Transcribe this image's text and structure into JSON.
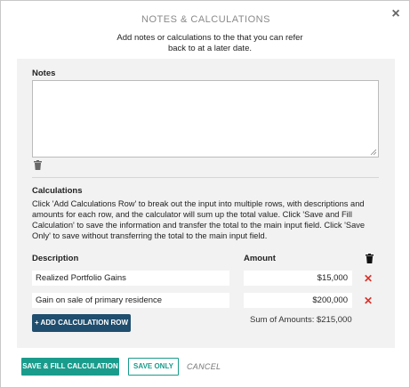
{
  "dialog": {
    "title": "NOTES & CALCULATIONS",
    "close_symbol": "×",
    "subtitle": "Add notes or calculations to the that you can refer back to at a later date."
  },
  "notes": {
    "label": "Notes",
    "value": "",
    "trash_icon": "trash-icon"
  },
  "calculations": {
    "label": "Calculations",
    "description": "Click 'Add Calculations Row' to break out the input into multiple rows, with descriptions and amounts for each row, and the calculator will sum up the total value. Click 'Save and Fill Calculation' to save the information and transfer the total to the main input field. Click 'Save Only' to save without transferring the total to the main input field.",
    "columns": {
      "description": "Description",
      "amount": "Amount"
    },
    "rows": [
      {
        "description": "Realized Portfolio Gains",
        "amount": "$15,000",
        "delete_symbol": "✕"
      },
      {
        "description": "Gain on sale of primary residence",
        "amount": "$200,000",
        "delete_symbol": "✕"
      }
    ],
    "add_row_label": "+ ADD CALCULATION ROW",
    "sum_label": "Sum of Amounts: $215,000"
  },
  "footer": {
    "save_fill_label": "SAVE & FILL CALCULATION",
    "save_only_label": "SAVE ONLY",
    "cancel_label": "CANCEL"
  },
  "colors": {
    "primary_teal": "#1a9c8c",
    "navy": "#1f4e6e",
    "delete_red": "#d9322b",
    "panel_bg": "#f2f2f2"
  }
}
